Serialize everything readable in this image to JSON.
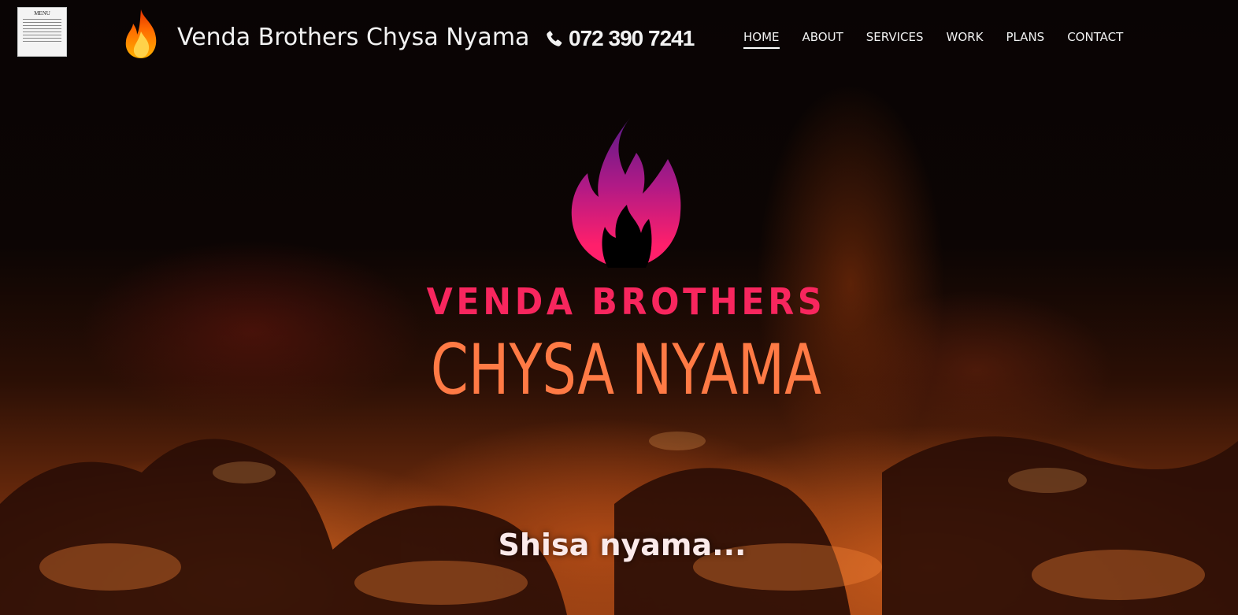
{
  "header": {
    "menu_thumbnail": {
      "title": "MENU",
      "icon": "menu-document-thumbnail"
    },
    "brand": {
      "name": "Venda Brothers Chysa Nyama",
      "icon": "flame-icon"
    },
    "phone": {
      "number": "072 390 7241",
      "icon": "phone-icon"
    },
    "nav": [
      {
        "label": "HOME",
        "active": true
      },
      {
        "label": "ABOUT",
        "active": false
      },
      {
        "label": "SERVICES",
        "active": false
      },
      {
        "label": "WORK",
        "active": false
      },
      {
        "label": "PLANS",
        "active": false
      },
      {
        "label": "CONTACT",
        "active": false
      }
    ]
  },
  "hero": {
    "logo_icon": "flame-logo",
    "line1": "VENDA BROTHERS",
    "line2": "CHYSA NYAMA",
    "tagline": "Shisa nyama..."
  },
  "colors": {
    "line1": "#f8265e",
    "line2": "#ff7a45",
    "logo_top": "#5b1a8a",
    "logo_bottom": "#ff1f6b",
    "nav_text": "#f2f2f2"
  }
}
